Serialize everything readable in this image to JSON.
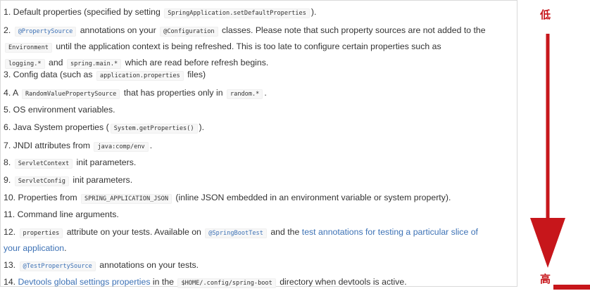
{
  "items": [
    {
      "num": "1.",
      "parts": [
        {
          "t": "text",
          "v": " Default properties (specified by setting "
        },
        {
          "t": "code",
          "v": "SpringApplication.setDefaultProperties"
        },
        {
          "t": "text",
          "v": ")."
        }
      ]
    },
    {
      "num": "2.",
      "parts": [
        {
          "t": "text",
          "v": " "
        },
        {
          "t": "codelink",
          "v": "@PropertySource"
        },
        {
          "t": "text",
          "v": " annotations on your "
        },
        {
          "t": "code",
          "v": "@Configuration"
        },
        {
          "t": "text",
          "v": " classes. Please note that such property sources are not added to the "
        },
        {
          "t": "br"
        },
        {
          "t": "code",
          "v": "Environment"
        },
        {
          "t": "text",
          "v": " until the application context is being refreshed. This is too late to configure certain properties such as "
        },
        {
          "t": "br"
        },
        {
          "t": "code",
          "v": "logging.*"
        },
        {
          "t": "text",
          "v": " and "
        },
        {
          "t": "code",
          "v": "spring.main.*"
        },
        {
          "t": "text",
          "v": " which are read before refresh begins."
        }
      ]
    },
    {
      "num": "3.",
      "parts": [
        {
          "t": "text",
          "v": " Config data (such as "
        },
        {
          "t": "code",
          "v": "application.properties"
        },
        {
          "t": "text",
          "v": " files)"
        }
      ]
    },
    {
      "num": "4.",
      "parts": [
        {
          "t": "text",
          "v": " A "
        },
        {
          "t": "code",
          "v": "RandomValuePropertySource"
        },
        {
          "t": "text",
          "v": " that has properties only in "
        },
        {
          "t": "code",
          "v": "random.*"
        },
        {
          "t": "text",
          "v": "."
        }
      ]
    },
    {
      "num": "5.",
      "parts": [
        {
          "t": "text",
          "v": " OS environment variables."
        }
      ]
    },
    {
      "num": "6.",
      "parts": [
        {
          "t": "text",
          "v": " Java System properties ("
        },
        {
          "t": "code",
          "v": "System.getProperties()"
        },
        {
          "t": "text",
          "v": ")."
        }
      ]
    },
    {
      "num": "7.",
      "parts": [
        {
          "t": "text",
          "v": " JNDI attributes from "
        },
        {
          "t": "code",
          "v": "java:comp/env"
        },
        {
          "t": "text",
          "v": "."
        }
      ]
    },
    {
      "num": "8.",
      "parts": [
        {
          "t": "text",
          "v": " "
        },
        {
          "t": "code",
          "v": "ServletContext"
        },
        {
          "t": "text",
          "v": " init parameters."
        }
      ]
    },
    {
      "num": "9.",
      "parts": [
        {
          "t": "text",
          "v": " "
        },
        {
          "t": "code",
          "v": "ServletConfig"
        },
        {
          "t": "text",
          "v": " init parameters."
        }
      ]
    },
    {
      "num": "10.",
      "parts": [
        {
          "t": "text",
          "v": " Properties from "
        },
        {
          "t": "code",
          "v": "SPRING_APPLICATION_JSON"
        },
        {
          "t": "text",
          "v": " (inline JSON embedded in an environment variable or system property)."
        }
      ]
    },
    {
      "num": "11.",
      "parts": [
        {
          "t": "text",
          "v": " Command line arguments."
        }
      ]
    },
    {
      "num": "12.",
      "parts": [
        {
          "t": "text",
          "v": " "
        },
        {
          "t": "code",
          "v": "properties"
        },
        {
          "t": "text",
          "v": " attribute on your tests. Available on "
        },
        {
          "t": "codelink",
          "v": "@SpringBootTest"
        },
        {
          "t": "text",
          "v": " and the "
        },
        {
          "t": "link",
          "v": "test annotations for testing a particular slice of "
        },
        {
          "t": "br"
        },
        {
          "t": "link",
          "v": "your application"
        },
        {
          "t": "text",
          "v": "."
        }
      ]
    },
    {
      "num": "13.",
      "parts": [
        {
          "t": "text",
          "v": " "
        },
        {
          "t": "codelink",
          "v": "@TestPropertySource"
        },
        {
          "t": "text",
          "v": " annotations on your tests."
        }
      ]
    },
    {
      "num": "14.",
      "parts": [
        {
          "t": "text",
          "v": " "
        },
        {
          "t": "link",
          "v": "Devtools global settings properties"
        },
        {
          "t": "text",
          "v": " in the "
        },
        {
          "t": "code",
          "v": "$HOME/.config/spring-boot"
        },
        {
          "t": "text",
          "v": " directory when devtools is active."
        }
      ]
    }
  ],
  "priority": {
    "low_label": "低",
    "high_label": "高"
  },
  "colors": {
    "arrow": "#c7161b",
    "link": "#3c71b5",
    "text": "#333333"
  }
}
